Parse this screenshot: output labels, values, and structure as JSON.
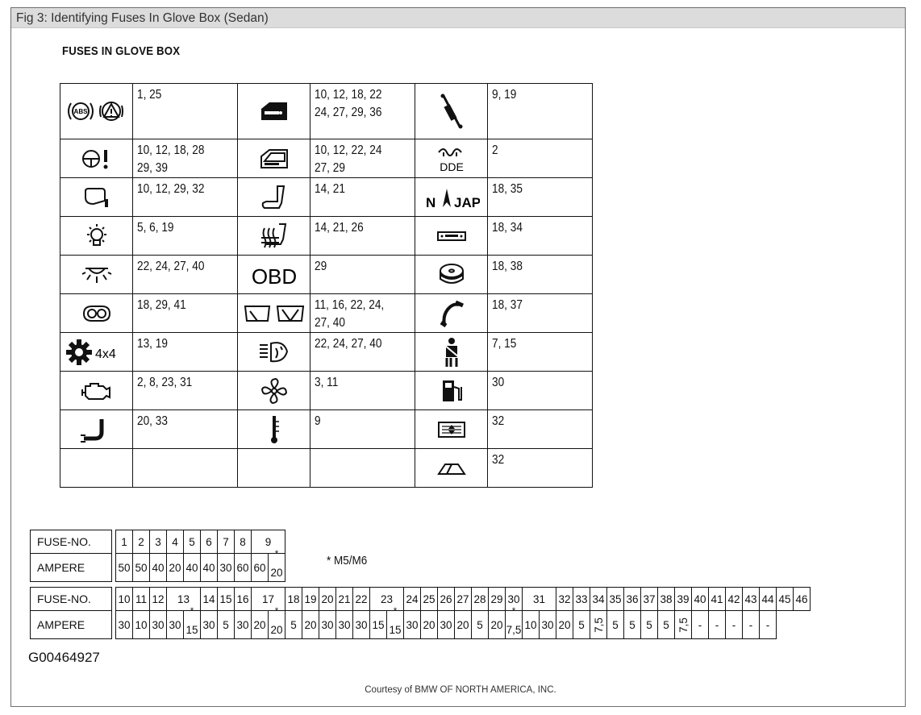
{
  "figure_title": "Fig 3: Identifying Fuses In Glove Box (Sedan)",
  "heading": "FUSES IN GLOVE BOX",
  "symbol_rows": [
    [
      {
        "icon": "abs-brake-warning-icon",
        "fuses": "1, 25"
      },
      {
        "icon": "door-lock-icon",
        "fuses": "10, 12, 18, 22\n24, 27, 29, 36"
      },
      {
        "icon": "shock-absorber-icon",
        "fuses": "9, 19"
      }
    ],
    [
      {
        "icon": "steering-warning-icon",
        "fuses": "10, 12, 18, 28\n29, 39"
      },
      {
        "icon": "window-lift-icon",
        "fuses": "10, 12, 22, 24\n27, 29"
      },
      {
        "icon": "glow-plug-dde-icon",
        "fuses": "2"
      }
    ],
    [
      {
        "icon": "mirror-icon",
        "fuses": "10, 12, 29, 32"
      },
      {
        "icon": "seat-icon",
        "fuses": "14, 21"
      },
      {
        "icon": "navigation-icon",
        "fuses": "18, 35"
      }
    ],
    [
      {
        "icon": "light-bulb-icon",
        "fuses": "5, 6, 19"
      },
      {
        "icon": "seat-heating-icon",
        "fuses": "14, 21, 26"
      },
      {
        "icon": "radio-icon",
        "fuses": "18, 34"
      }
    ],
    [
      {
        "icon": "interior-light-icon",
        "fuses": "22, 24, 27, 40"
      },
      {
        "icon": "obd-icon",
        "fuses": "29"
      },
      {
        "icon": "cd-changer-icon",
        "fuses": "18, 38"
      }
    ],
    [
      {
        "icon": "instrument-cluster-icon",
        "fuses": "18, 29, 41"
      },
      {
        "icon": "wipers-icon",
        "fuses": "11, 16, 22, 24,\n27, 40"
      },
      {
        "icon": "telephone-icon",
        "fuses": "18, 37"
      }
    ],
    [
      {
        "icon": "4x4-gear-icon",
        "fuses": "13, 19"
      },
      {
        "icon": "headlight-washer-icon",
        "fuses": "22, 24, 27, 40"
      },
      {
        "icon": "seat-belt-icon",
        "fuses": "7, 15"
      }
    ],
    [
      {
        "icon": "engine-icon",
        "fuses": "2, 8, 23, 31"
      },
      {
        "icon": "fan-icon",
        "fuses": "3, 11"
      },
      {
        "icon": "fuel-pump-icon",
        "fuses": "30"
      }
    ],
    [
      {
        "icon": "exhaust-icon",
        "fuses": "20, 33"
      },
      {
        "icon": "thermometer-icon",
        "fuses": "9"
      },
      {
        "icon": "heated-rear-window-icon",
        "fuses": "32"
      }
    ],
    [
      {
        "icon": "",
        "fuses": ""
      },
      {
        "icon": "",
        "fuses": ""
      },
      {
        "icon": "sunroof-icon",
        "fuses": "32"
      }
    ]
  ],
  "obd_text": "OBD",
  "dde_text": "DDE",
  "nav_left": "N",
  "nav_right": "JAP",
  "fourx4_text": "4x4",
  "table1": {
    "fuse_label": "FUSE-NO.",
    "amp_label": "AMPERE",
    "fuses": [
      "1",
      "2",
      "3",
      "4",
      "5",
      "6",
      "7",
      "8",
      "9"
    ],
    "amperes": [
      "50",
      "50",
      "40",
      "20",
      "40",
      "40",
      "30",
      "60",
      "60",
      "20"
    ],
    "starred_index": 9
  },
  "note": "* M5/M6",
  "table2": {
    "fuse_label": "FUSE-NO.",
    "amp_label": "AMPERE",
    "fuses": [
      "10",
      "11",
      "12",
      "13",
      "14",
      "15",
      "16",
      "17",
      "18",
      "19",
      "20",
      "21",
      "22",
      "23",
      "24",
      "25",
      "26",
      "27",
      "28",
      "29",
      "30",
      "31",
      "32",
      "33",
      "34",
      "35",
      "36",
      "37",
      "38",
      "39",
      "40",
      "41",
      "42",
      "43",
      "44",
      "45",
      "46"
    ],
    "amperes": [
      "30",
      "10",
      "30",
      "30",
      "15",
      "30",
      "5",
      "30",
      "20",
      "30",
      "5",
      "20",
      "30",
      "30",
      "30",
      "15",
      "30",
      "30",
      "20",
      "30",
      "20",
      "5",
      "20",
      "7,5",
      "10",
      "30",
      "20",
      "5",
      "7,5",
      "5",
      "5",
      "5",
      "5",
      "7,5",
      "-",
      "-",
      "-",
      "-",
      "-"
    ],
    "spans": {
      "13": 2,
      "17": 2,
      "23": 2,
      "31": 2
    },
    "starred": [
      "15",
      "20",
      "15",
      "7,5"
    ],
    "rotated": [
      "7,5",
      "7,5"
    ]
  },
  "figure_id": "G00464927",
  "courtesy": "Courtesy of BMW OF NORTH AMERICA, INC."
}
